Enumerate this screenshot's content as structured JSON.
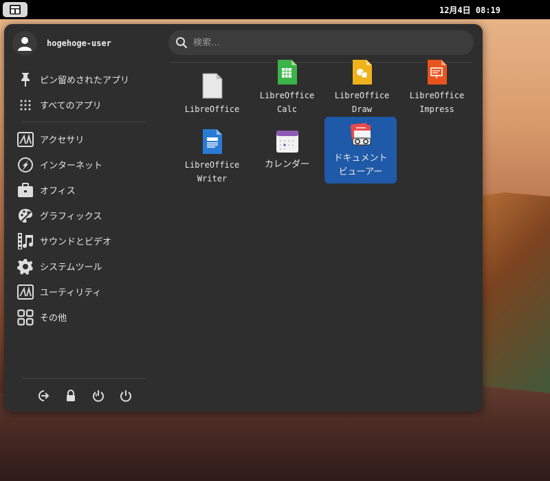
{
  "panel": {
    "clock": "12月4日 08:19"
  },
  "user": {
    "name": "hogehoge-user"
  },
  "search": {
    "placeholder": "検索…"
  },
  "sidebar": {
    "top_items": [
      {
        "label": "ピン留めされたアプリ",
        "icon": "pin-icon"
      },
      {
        "label": "すべてのアプリ",
        "icon": "grid-icon"
      }
    ],
    "categories": [
      {
        "label": "アクセサリ",
        "icon": "accessories-icon"
      },
      {
        "label": "インターネット",
        "icon": "internet-icon"
      },
      {
        "label": "オフィス",
        "icon": "office-icon"
      },
      {
        "label": "グラフィックス",
        "icon": "graphics-icon"
      },
      {
        "label": "サウンドとビデオ",
        "icon": "multimedia-icon"
      },
      {
        "label": "システムツール",
        "icon": "gear-icon"
      },
      {
        "label": "ユーティリティ",
        "icon": "utilities-icon"
      },
      {
        "label": "その他",
        "icon": "other-icon"
      }
    ]
  },
  "apps": [
    {
      "label": "LibreOffice",
      "icon": "libreoffice-icon"
    },
    {
      "label": "LibreOffice\nCalc",
      "icon": "calc-icon"
    },
    {
      "label": "LibreOffice\nDraw",
      "icon": "draw-icon"
    },
    {
      "label": "LibreOffice\nImpress",
      "icon": "impress-icon"
    },
    {
      "label": "LibreOffice\nWriter",
      "icon": "writer-icon"
    },
    {
      "label": "カレンダー",
      "icon": "calendar-icon"
    },
    {
      "label": "ドキュメント\nビューアー",
      "icon": "document-viewer-icon",
      "selected": true
    }
  ],
  "colors": {
    "panel_bg": "#000000",
    "launcher_bg": "#2e2e2e",
    "selection": "#1f5aa8"
  }
}
